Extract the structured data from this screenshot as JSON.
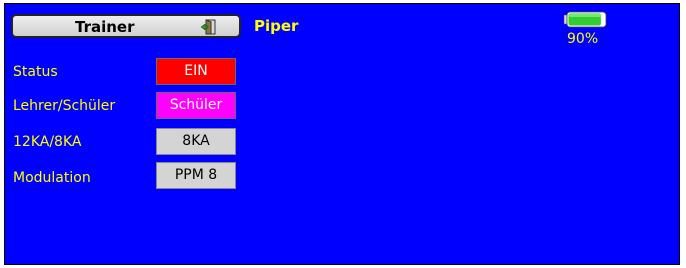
{
  "header": {
    "title": "Trainer",
    "model_name": "Piper",
    "battery_percent": "90%",
    "battery_level": 0.9,
    "icons": [
      "door-exit-icon",
      "battery-icon"
    ]
  },
  "settings": [
    {
      "label": "Status",
      "value": "EIN",
      "color": "#ff0000"
    },
    {
      "label": "Lehrer/Schüler",
      "value": "Schüler",
      "color": "#ff00ff"
    },
    {
      "label": "12KA/8KA",
      "value": "8KA",
      "color": "#d4d4d4"
    },
    {
      "label": "Modulation",
      "value": "PPM 8",
      "color": "#d4d4d4"
    }
  ],
  "colors": {
    "background": "#0000fe",
    "label": "#ffff00",
    "battery_fill": "#33cc33"
  }
}
